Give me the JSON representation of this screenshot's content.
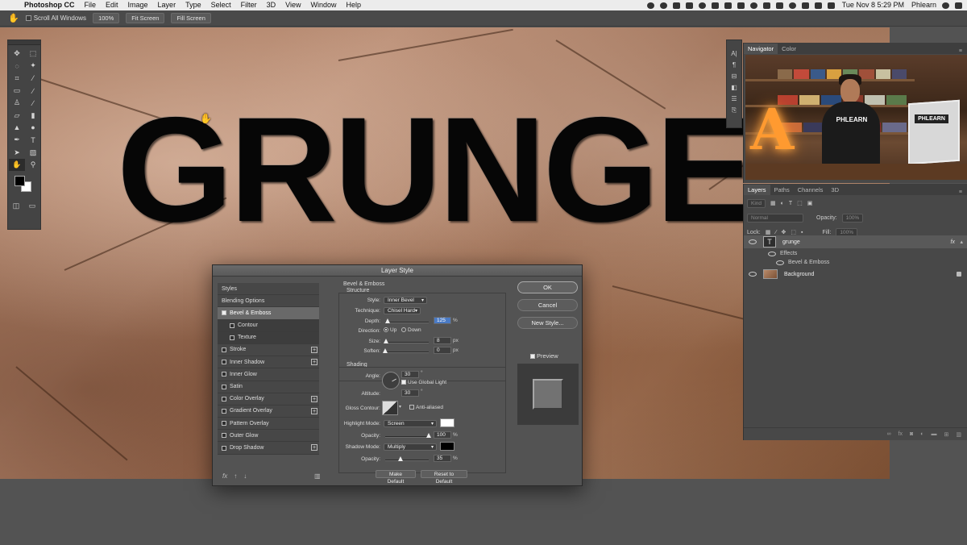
{
  "menubar": {
    "app_name": "Photoshop CC",
    "menus": [
      "File",
      "Edit",
      "Image",
      "Layer",
      "Type",
      "Select",
      "Filter",
      "3D",
      "View",
      "Window",
      "Help"
    ],
    "clock": "Tue Nov 8  5:29 PM",
    "user": "Phlearn"
  },
  "options_bar": {
    "scroll_all_windows": "Scroll All Windows",
    "zoom_100": "100%",
    "fit_screen": "Fit Screen",
    "fill_screen": "Fill Screen"
  },
  "canvas": {
    "text": "GRUNGE"
  },
  "navigator": {
    "tabs": [
      "Navigator",
      "Color"
    ],
    "shirt_text": "PHLEARN",
    "monitor_text": "PHLEARN",
    "sign_letter": "A"
  },
  "layers": {
    "tabs": [
      "Layers",
      "Paths",
      "Channels",
      "3D"
    ],
    "kind_filter": "Kind",
    "blend_mode": "Normal",
    "opacity_label": "Opacity:",
    "opacity_value": "100%",
    "lock_label": "Lock:",
    "fill_label": "Fill:",
    "fill_value": "100%",
    "items": [
      {
        "name": "grunge",
        "fx": "fx"
      },
      {
        "name": "Effects"
      },
      {
        "name": "Bevel & Emboss"
      },
      {
        "name": "Background"
      }
    ]
  },
  "dialog": {
    "title": "Layer Style",
    "styles_header": "Styles",
    "styles": [
      "Blending Options",
      "Bevel & Emboss",
      "Contour",
      "Texture",
      "Stroke",
      "Inner Shadow",
      "Inner Glow",
      "Satin",
      "Color Overlay",
      "Gradient Overlay",
      "Pattern Overlay",
      "Outer Glow",
      "Drop Shadow"
    ],
    "section_title": "Bevel & Emboss",
    "structure": {
      "title": "Structure",
      "style_label": "Style:",
      "style_value": "Inner Bevel",
      "technique_label": "Technique:",
      "technique_value": "Chisel Hard",
      "depth_label": "Depth:",
      "depth_value": "125",
      "depth_percent": 0.125,
      "direction_label": "Direction:",
      "direction_up": "Up",
      "direction_down": "Down",
      "size_label": "Size:",
      "size_value": "8",
      "soften_label": "Soften:",
      "soften_value": "0",
      "unit_percent": "%",
      "unit_px": "px"
    },
    "shading": {
      "title": "Shading",
      "angle_label": "Angle:",
      "angle_value": "30",
      "degree": "°",
      "use_global_light": "Use Global Light",
      "altitude_label": "Altitude:",
      "altitude_value": "30",
      "gloss_contour_label": "Gloss Contour:",
      "anti_aliased": "Anti-aliased",
      "highlight_mode_label": "Highlight Mode:",
      "highlight_mode_value": "Screen",
      "highlight_color": "#ffffff",
      "highlight_opacity_label": "Opacity:",
      "highlight_opacity_value": "100",
      "shadow_mode_label": "Shadow Mode:",
      "shadow_mode_value": "Multiply",
      "shadow_color": "#000000",
      "shadow_opacity_label": "Opacity:",
      "shadow_opacity_value": "35"
    },
    "make_default": "Make Default",
    "reset_to_default": "Reset to Default",
    "ok": "OK",
    "cancel": "Cancel",
    "new_style": "New Style...",
    "preview": "Preview"
  }
}
